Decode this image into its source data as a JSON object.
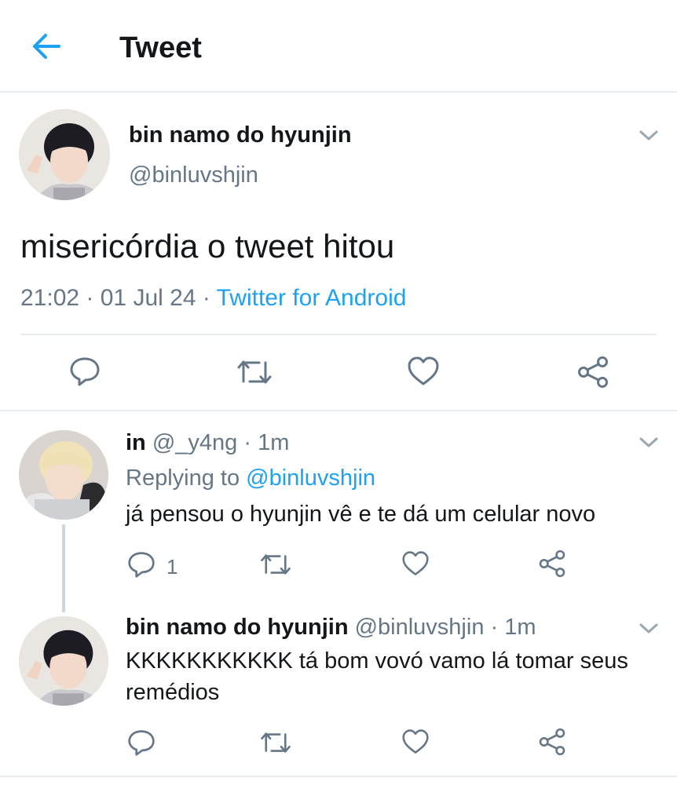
{
  "header": {
    "title": "Tweet",
    "back_icon": "arrow-left-icon",
    "accent_color": "#1da1f2"
  },
  "main_tweet": {
    "author_name": "bin namo do hyunjin",
    "author_handle": "@binluvshjin",
    "text": "misericórdia o tweet hitou",
    "time": "21:02",
    "date": "01 Jul 24",
    "source": "Twitter for Android",
    "separator": " · ",
    "actions": [
      "reply-icon",
      "retweet-icon",
      "like-icon",
      "share-icon"
    ]
  },
  "replies": [
    {
      "author_name": "in",
      "author_handle": "@_y4ng",
      "time_ago": "1m",
      "replying_prefix": "Replying to ",
      "replying_to": "@binluvshjin",
      "text": "já pensou o hyunjin vê e te dá um celular novo",
      "reply_count": "1"
    },
    {
      "author_name": "bin namo do hyunjin",
      "author_handle": "@binluvshjin",
      "time_ago": "1m",
      "text": "KKKKKKKKKKK tá bom vovó vamo lá tomar seus remédios",
      "reply_count": ""
    }
  ],
  "colors": {
    "text_primary": "#14171a",
    "text_secondary": "#657786",
    "link": "#1da1f2",
    "divider": "#e6ecf0"
  }
}
